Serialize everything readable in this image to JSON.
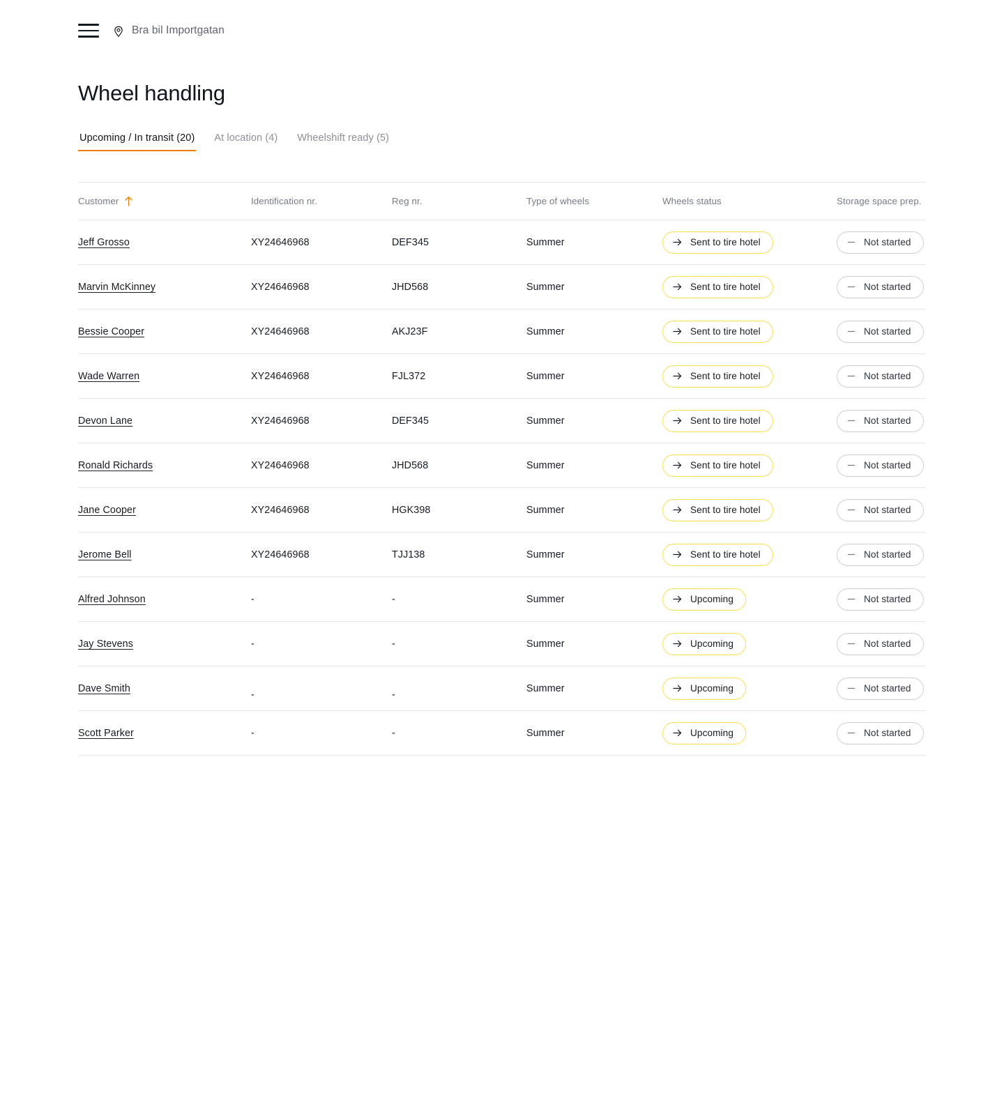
{
  "header": {
    "menu_icon": "hamburger-menu-icon",
    "location_icon": "map-pin-icon",
    "location_label": "Bra bil Importgatan"
  },
  "page": {
    "title": "Wheel handling"
  },
  "tabs": [
    {
      "label": "Upcoming / In transit (20)",
      "active": true
    },
    {
      "label": "At location (4)",
      "active": false
    },
    {
      "label": "Wheelshift ready (5)",
      "active": false
    }
  ],
  "table": {
    "sort": {
      "column": "Customer",
      "direction": "asc",
      "icon": "arrow-up-icon"
    },
    "columns": [
      {
        "key": "customer",
        "label": "Customer"
      },
      {
        "key": "identification",
        "label": "Identification nr."
      },
      {
        "key": "reg",
        "label": "Reg nr."
      },
      {
        "key": "type",
        "label": "Type of wheels"
      },
      {
        "key": "status",
        "label": "Wheels status"
      },
      {
        "key": "prep",
        "label": "Storage space prep."
      }
    ],
    "rows": [
      {
        "customer": "Jeff Grosso",
        "identification": "XY24646968",
        "reg": "DEF345",
        "type": "Summer",
        "status": "Sent to tire hotel",
        "status_icon": "arrow-right-icon",
        "prep": "Not started",
        "prep_icon": "minus-icon"
      },
      {
        "customer": "Marvin McKinney",
        "identification": "XY24646968",
        "reg": "JHD568",
        "type": "Summer",
        "status": "Sent to tire hotel",
        "status_icon": "arrow-right-icon",
        "prep": "Not started",
        "prep_icon": "minus-icon"
      },
      {
        "customer": "Bessie Cooper",
        "identification": "XY24646968",
        "reg": "AKJ23F",
        "type": "Summer",
        "status": "Sent to tire hotel",
        "status_icon": "arrow-right-icon",
        "prep": "Not started",
        "prep_icon": "minus-icon"
      },
      {
        "customer": "Wade Warren",
        "identification": "XY24646968",
        "reg": "FJL372",
        "type": "Summer",
        "status": "Sent to tire hotel",
        "status_icon": "arrow-right-icon",
        "prep": "Not started",
        "prep_icon": "minus-icon"
      },
      {
        "customer": "Devon Lane",
        "identification": "XY24646968",
        "reg": "DEF345",
        "type": "Summer",
        "status": "Sent to tire hotel",
        "status_icon": "arrow-right-icon",
        "prep": "Not started",
        "prep_icon": "minus-icon"
      },
      {
        "customer": "Ronald Richards",
        "identification": "XY24646968",
        "reg": "JHD568",
        "type": "Summer",
        "status": "Sent to tire hotel",
        "status_icon": "arrow-right-icon",
        "prep": "Not started",
        "prep_icon": "minus-icon"
      },
      {
        "customer": "Jane Cooper",
        "identification": "XY24646968",
        "reg": "HGK398",
        "type": "Summer",
        "status": "Sent to tire hotel",
        "status_icon": "arrow-right-icon",
        "prep": "Not started",
        "prep_icon": "minus-icon"
      },
      {
        "customer": "Jerome Bell",
        "identification": "XY24646968",
        "reg": "TJJ138",
        "type": "Summer",
        "status": "Sent to tire hotel",
        "status_icon": "arrow-right-icon",
        "prep": "Not started",
        "prep_icon": "minus-icon"
      },
      {
        "customer": "Alfred Johnson",
        "identification": "-",
        "reg": "-",
        "type": "Summer",
        "status": "Upcoming",
        "status_icon": "arrow-right-icon",
        "prep": "Not started",
        "prep_icon": "minus-icon"
      },
      {
        "customer": "Jay Stevens",
        "identification": "-",
        "reg": "-",
        "type": "Summer",
        "status": "Upcoming",
        "status_icon": "arrow-right-icon",
        "prep": "Not started",
        "prep_icon": "minus-icon"
      },
      {
        "customer": "Dave Smith",
        "identification": "-",
        "reg": "-",
        "type": "Summer",
        "status": "Upcoming",
        "status_icon": "arrow-right-icon",
        "prep": "Not started",
        "prep_icon": "minus-icon"
      },
      {
        "customer": "Scott Parker",
        "identification": "-",
        "reg": "-",
        "type": "Summer",
        "status": "Upcoming",
        "status_icon": "arrow-right-icon",
        "prep": "Not started",
        "prep_icon": "minus-icon"
      }
    ]
  },
  "colors": {
    "accent_orange": "#f07d00",
    "pill_yellow_border": "#ffe14a",
    "pill_gray_border": "#cdd0d4",
    "text_primary": "#151c24",
    "text_muted": "#767c86",
    "row_divider": "#ebe9e4"
  }
}
